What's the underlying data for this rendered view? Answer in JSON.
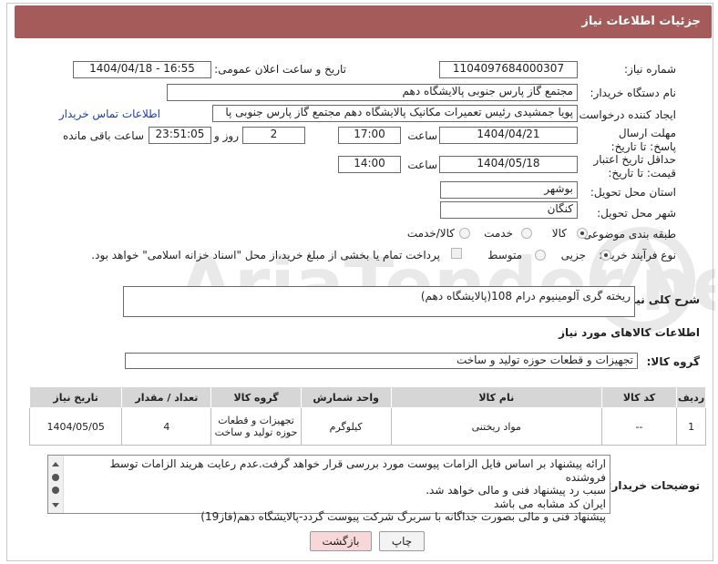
{
  "header": {
    "title": "جزئیات اطلاعات نیاز"
  },
  "fields": {
    "need_number_label": "شماره نیاز:",
    "need_number": "1104097684000307",
    "announce_label": "تاریخ و ساعت اعلان عمومی:",
    "announce_value": "1404/04/18 - 16:55",
    "buyer_org_label": "نام دستگاه خریدار:",
    "buyer_org": "مجتمع گاز پارس جنوبی  پالایشگاه دهم",
    "requester_label": "ایجاد کننده درخواست:",
    "requester": "پویا جمشیدی رئیس تعمیرات مکانیک پالایشگاه دهم  مجتمع گاز پارس جنوبی  پا",
    "buyer_contact_link": "اطلاعات تماس خریدار",
    "deadline_label": "مهلت ارسال پاسخ: تا تاریخ:",
    "deadline_date": "1404/04/21",
    "hour_label": "ساعت",
    "deadline_time": "17:00",
    "days_value": "2",
    "days_label": "روز و",
    "remaining_time": "23:51:05",
    "remaining_label": "ساعت باقی مانده",
    "validity_label": "حداقل تاریخ اعتبار قیمت: تا تاریخ:",
    "validity_date": "1404/05/18",
    "validity_time": "14:00",
    "province_label": "استان محل تحویل:",
    "province": "بوشهر",
    "city_label": "شهر محل تحویل:",
    "city": "کنگان",
    "category_label": "طبقه بندی موضوعی:",
    "category_options": [
      "کالا",
      "خدمت",
      "کالا/خدمت"
    ],
    "purchase_label": "نوع فرآیند خرید :",
    "purchase_options": [
      "جزیی",
      "متوسط"
    ],
    "payment_note": "پرداخت تمام یا بخشی از مبلغ خرید،از محل \"اسناد خزانه اسلامی\" خواهد بود."
  },
  "description": {
    "label": "شرح کلی نیاز:",
    "value": "ریخته گری آلومینیوم درام 108(پالایشگاه دهم)"
  },
  "goods": {
    "section_title": "اطلاعات کالاهای مورد نیاز",
    "group_label": "گروه کالا:",
    "group_value": "تجهیزات و قطعات حوزه تولید و ساخت",
    "columns": [
      "ردیف",
      "کد کالا",
      "نام کالا",
      "واحد شمارش",
      "گروه کالا",
      "تعداد / مقدار",
      "تاریخ نیاز"
    ],
    "rows": [
      {
        "row": "1",
        "code": "--",
        "name": "مواد ریختنی",
        "unit": "کیلوگرم",
        "group": "تجهیزات و قطعات حوزه تولید و ساخت",
        "qty": "4",
        "date": "1404/05/05"
      }
    ]
  },
  "notes": {
    "label": "توضیحات خریدار:",
    "lines": [
      "ارائه پیشنهاد بر اساس فایل الزامات پیوست مورد بررسی قرار خواهد گرفت.عدم رعایت هریند الزامات توسط فروشنده",
      "سبب رد پیشنهاد فنی و مالی خواهد شد.",
      "ایران کد مشابه می باشد",
      "پیشنهاد فنی و مالی بصورت جداگانه با سربرگ شرکت پیوست گردد-پالایشگاه دهم(فاز19)"
    ]
  },
  "buttons": {
    "print": "چاپ",
    "back": "بازگشت"
  },
  "watermark": {
    "text": "AriaTender.neT"
  },
  "colors": {
    "header_bg": "#a65b5b",
    "back_btn_bg": "#f7d7d7",
    "link": "#1a3fb4"
  }
}
